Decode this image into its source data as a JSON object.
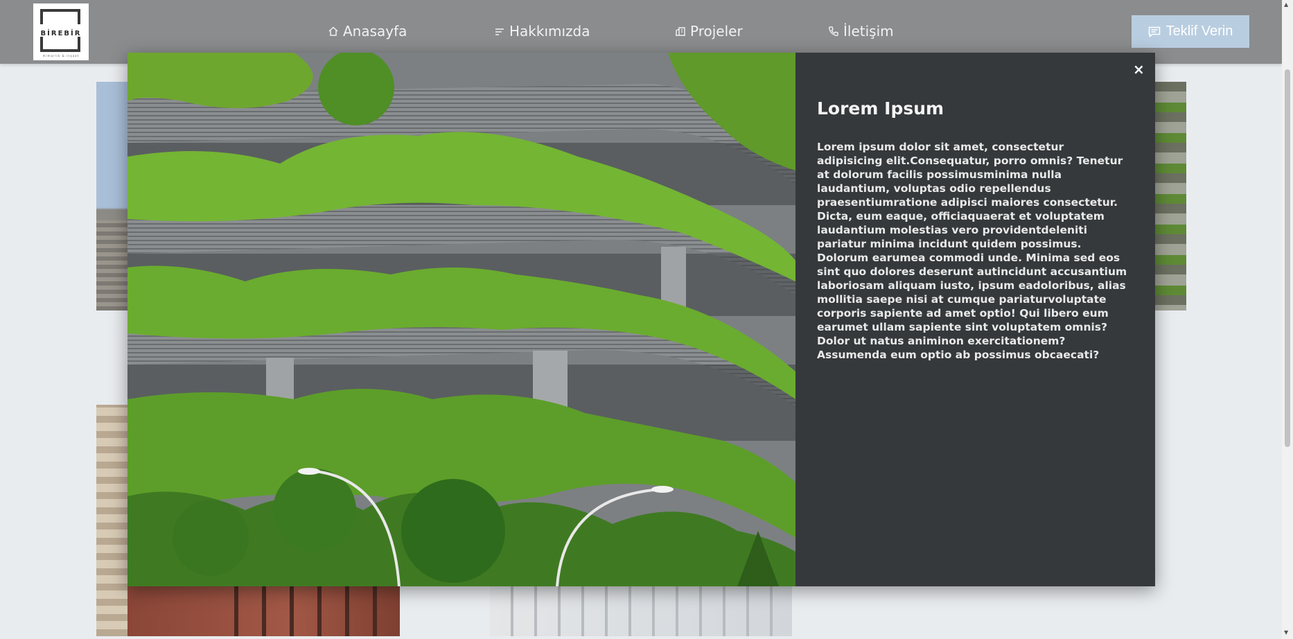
{
  "brand": {
    "logo_text": "BİREBİR",
    "logo_subtext": "mimarlık & inşaat"
  },
  "nav": {
    "items": [
      {
        "label": "Anasayfa",
        "icon": "home-icon"
      },
      {
        "label": "Hakkımızda",
        "icon": "lines-icon"
      },
      {
        "label": "Projeler",
        "icon": "building-icon"
      },
      {
        "label": "İletişim",
        "icon": "phone-icon"
      }
    ],
    "cta_label": "Teklif Verin",
    "cta_icon": "message-icon"
  },
  "modal": {
    "close_label": "×",
    "title": "Lorem Ipsum",
    "body": "Lorem ipsum dolor sit amet, consectetur adipisicing elit.Consequatur, porro omnis? Tenetur at dolorum facilis possimusminima nulla laudantium, voluptas odio repellendus praesentiumratione adipisci maiores consectetur. Dicta, eum eaque, officiaquaerat et voluptatem laudantium molestias vero providentdeleniti pariatur minima incidunt quidem possimus. Dolorum earumea commodi unde. Minima sed eos sint quo dolores deserunt autincidunt accusantium laboriosam aliquam iusto, ipsum eadoloribus, alias mollitia saepe nisi at cumque pariaturvoluptate corporis sapiente ad amet optio! Qui libero eum earumet ullam sapiente sint voluptatem omnis? Dolor ut natus animinon exercitationem? Assumenda eum optio ab possimus obcaecati?"
  },
  "colors": {
    "header_bg": "#8a8c8e",
    "cta_bg": "#b9cde0",
    "modal_bg": "#35393c",
    "page_bg": "#e9ecef"
  }
}
